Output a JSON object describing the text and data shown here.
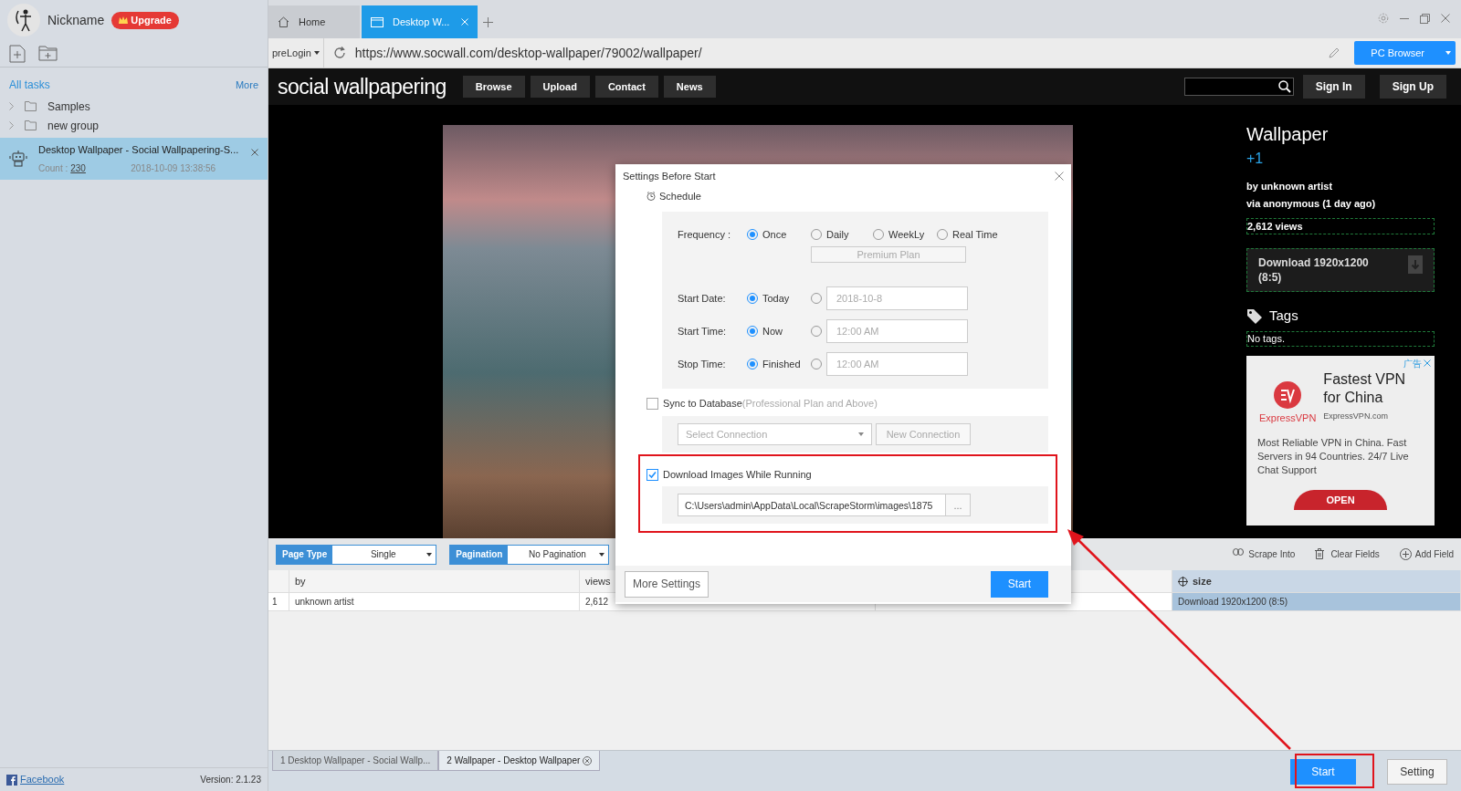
{
  "sidebar": {
    "nickname": "Nickname",
    "upgrade": "Upgrade",
    "all_tasks": "All tasks",
    "more": "More",
    "groups": [
      {
        "label": "Samples"
      },
      {
        "label": "new group"
      }
    ],
    "tasks": [
      {
        "title": "Desktop Wallpaper - Social Wallpapering-S...",
        "count_label": "Count :",
        "count": "230",
        "date": "2018-10-09 13:38:56",
        "selected": true
      }
    ],
    "footer_link": "Facebook",
    "version": "Version: 2.1.23"
  },
  "browser": {
    "tabs": [
      {
        "label": "Home",
        "kind": "home",
        "selected": false
      },
      {
        "label": "Desktop W...",
        "kind": "page",
        "selected": true
      }
    ],
    "login": "preLogin",
    "url": "https://www.socwall.com/desktop-wallpaper/79002/wallpaper/",
    "mode_button": "PC Browser"
  },
  "site": {
    "logo": "social wallpapering",
    "nav": [
      "Browse",
      "Upload",
      "Contact",
      "News"
    ],
    "sign_in": "Sign In",
    "sign_up": "Sign Up",
    "title": "Wallpaper",
    "plus": "+1",
    "by": "by unknown artist",
    "via": "via anonymous (1 day ago)",
    "views": "2,612 views",
    "download": "Download 1920x1200 (8:5)",
    "tags_heading": "Tags",
    "tags": "No tags.",
    "ad": {
      "marker": "广告",
      "headline": "Fastest VPN for China",
      "brand": "ExpressVPN",
      "domain": "ExpressVPN.com",
      "body": "Most Reliable VPN in China. Fast Servers in 94 Countries. 24/7 Live Chat Support",
      "button": "OPEN"
    }
  },
  "extractor": {
    "page_type_label": "Page Type",
    "page_type": "Single",
    "pagination_label": "Pagination",
    "pagination": "No Pagination",
    "actions": [
      {
        "label": "Scrape Into",
        "kind": "link"
      },
      {
        "label": "Clear Fields",
        "kind": "trash"
      },
      {
        "label": "Add Field",
        "kind": "add"
      }
    ],
    "columns": [
      {
        "label": "by",
        "selected": false
      },
      {
        "label": "views",
        "selected": false
      },
      {
        "label": "size",
        "selected": true
      }
    ],
    "rows": [
      {
        "index": "1",
        "cells": [
          "unknown artist",
          "2,612",
          "Download 1920x1200 (8:5)"
        ]
      }
    ]
  },
  "bottom_tabs": [
    {
      "label": "1 Desktop Wallpaper - Social Wallp...",
      "selected": false
    },
    {
      "label": "2 Wallpaper - Desktop Wallpaper",
      "selected": true
    }
  ],
  "start": "Start",
  "setting": "Setting",
  "dialog": {
    "title": "Settings Before Start",
    "schedule": "Schedule",
    "rows": [
      {
        "label": "Frequency :",
        "kind": "frequency",
        "options": [
          {
            "label": "Once",
            "selected": true
          },
          {
            "label": "Daily",
            "selected": false
          },
          {
            "label": "WeekLy",
            "selected": false
          },
          {
            "label": "Real Time",
            "selected": false
          }
        ],
        "note": "Premium Plan"
      },
      {
        "label": "Start Date:",
        "kind": "choice",
        "preset": {
          "label": "Today",
          "selected": true
        },
        "custom": {
          "value": "2018-10-8",
          "selected": false
        }
      },
      {
        "label": "Start Time:",
        "kind": "choice",
        "preset": {
          "label": "Now",
          "selected": true
        },
        "custom": {
          "value": "12:00 AM",
          "selected": false
        }
      },
      {
        "label": "Stop Time:",
        "kind": "choice",
        "preset": {
          "label": "Finished",
          "selected": true
        },
        "custom": {
          "value": "12:00 AM",
          "selected": false
        }
      }
    ],
    "sync": {
      "label": "Sync to Database",
      "note": "(Professional Plan and Above)",
      "checked": false,
      "connection_placeholder": "Select Connection",
      "new_connection": "New Connection"
    },
    "download": {
      "label": "Download Images While Running",
      "checked": true,
      "path": "C:\\Users\\admin\\AppData\\Local\\ScrapeStorm\\images\\1875",
      "browse": "..."
    },
    "more_settings": "More Settings",
    "start": "Start"
  }
}
